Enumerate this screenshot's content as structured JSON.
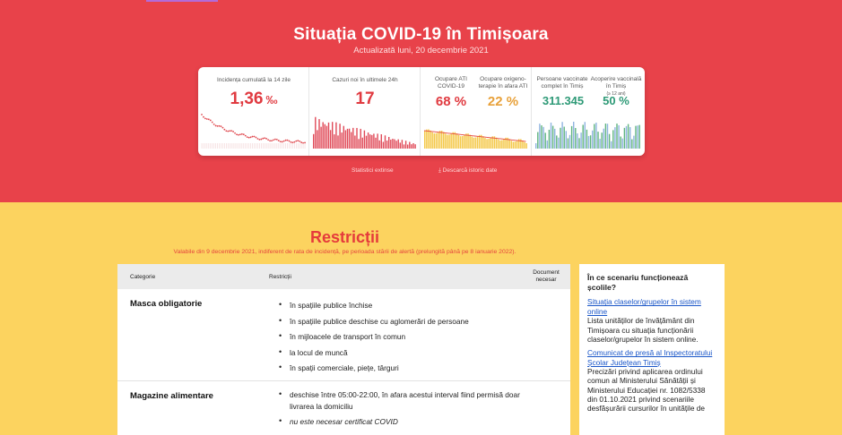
{
  "header": {
    "title": "Situația COVID-19 în Timișoara",
    "updated": "Actualizată luni, 20 decembrie 2021"
  },
  "stats": {
    "incidence": {
      "label": "Incidența cumulată la 14 zile",
      "value": "1,36",
      "unit": "‰",
      "color": "#e03a40"
    },
    "new_cases": {
      "label": "Cazuri noi în ultimele 24h",
      "value": "17",
      "color": "#e03a40"
    },
    "icu": {
      "label": "Ocupare ATI COVID-19",
      "value": "68 %",
      "color": "#e03a40"
    },
    "oxygen": {
      "label": "Ocupare oxigeno-terapie în afara ATI",
      "value": "22 %",
      "color": "#e8a13a"
    },
    "vaccinated": {
      "label": "Persoane vaccinate complet în Timiș",
      "value": "311.345",
      "color": "#2e9a77"
    },
    "coverage": {
      "label": "Acoperire vaccinală în Timiș",
      "label_note": "(≥ 12 ani)",
      "value": "50 %",
      "color": "#2e9a77"
    }
  },
  "links": {
    "extended_stats": "Statistici extinse",
    "download": "⤓ Descarcă istoric date"
  },
  "restrictions": {
    "title": "Restricții",
    "subtitle": "Valabile din 9 decembrie 2021, indiferent de rata de incidență, pe perioada stării de alertă (prelungită până pe 8 ianuarie 2022).",
    "columns": [
      "Categorie",
      "Restricții",
      "Document necesar"
    ],
    "rows": [
      {
        "category": "Masca obligatorie",
        "items": [
          "în spațiile publice închise",
          "în spațiile publice deschise cu aglomerări de persoane",
          "în mijloacele de transport în comun",
          "la locul de muncă",
          "în spații comerciale, piețe, târguri"
        ]
      },
      {
        "category": "Magazine alimentare",
        "items": [
          "deschise între 05:00-22:00, în afara acestui interval fiind permisă doar livrarea la domiciliu",
          "nu este necesar certificat COVID"
        ]
      }
    ]
  },
  "sidebar": {
    "heading": "În ce scenariu funcționează școlile?",
    "link1": "Situația claselor/grupelor în sistem online",
    "text1": "Lista unităților de învățământ din Timișoara cu situația funcționării claselor/grupelor în sistem online.",
    "link2": "Comunicat de presă al Inspectoratului Școlar Județean Timiș",
    "text2": "Precizări privind aplicarea ordinului comun al Ministerului Sănătății și Ministerului Educației nr. 1082/5338 din 01.10.2021 privind scenariile desfășurării cursurilor în unitățile de"
  }
}
